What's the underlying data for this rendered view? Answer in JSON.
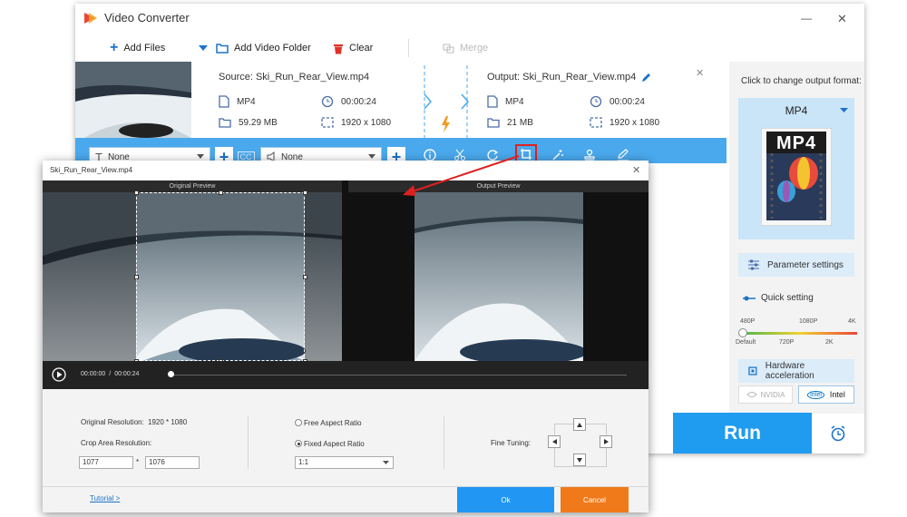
{
  "window": {
    "title": "Video Converter",
    "minimize_glyph": "—",
    "close_glyph": "✕"
  },
  "toolbar": {
    "add_files": "Add Files",
    "add_video_folder": "Add Video Folder",
    "clear": "Clear",
    "merge": "Merge"
  },
  "file_item": {
    "source_label": "Source: Ski_Run_Rear_View.mp4",
    "source_format": "MP4",
    "source_duration": "00:00:24",
    "source_size": "59.29 MB",
    "source_resolution": "1920 x 1080",
    "output_label": "Output: Ski_Run_Rear_View.mp4",
    "output_format": "MP4",
    "output_duration": "00:00:24",
    "output_size": "21 MB",
    "output_resolution": "1920 x 1080",
    "remove_glyph": "✕"
  },
  "edit_bar": {
    "subtitle_select": "None",
    "audio_select": "None",
    "cc_label": "CC",
    "icons": [
      "info-icon",
      "cut-icon",
      "rotate-icon",
      "crop-icon",
      "effects-icon",
      "watermark-icon",
      "edit-icon"
    ]
  },
  "right_panel": {
    "prompt": "Click to change output format:",
    "format_name": "MP4",
    "format_thumb_text": "MP4",
    "parameter_settings": "Parameter settings",
    "quick_setting": "Quick setting",
    "quality_top": [
      "480P",
      "1080P",
      "4K"
    ],
    "quality_bottom": [
      "Default",
      "720P",
      "2K"
    ],
    "hardware_acceleration": "Hardware acceleration",
    "nvidia": "NVIDIA",
    "intel_logo": "intel",
    "intel": "Intel",
    "run": "Run"
  },
  "crop_dialog": {
    "title": "Ski_Run_Rear_View.mp4",
    "close_glyph": "✕",
    "original_preview": "Original Preview",
    "output_preview": "Output Preview",
    "time_current": "00:00:00",
    "time_sep": "/",
    "time_total": "00:00:24",
    "original_resolution_label": "Original Resolution:",
    "original_resolution_value": "1920 * 1080",
    "crop_area_label": "Crop Area Resolution:",
    "crop_width": "1077",
    "crop_sep": "*",
    "crop_height": "1076",
    "free_aspect": "Free Aspect Ratio",
    "fixed_aspect": "Fixed Aspect Ratio",
    "aspect_value": "1:1",
    "fine_tuning": "Fine Tuning:",
    "tutorial": "Tutorial >",
    "ok": "Ok",
    "cancel": "Cancel"
  },
  "colors": {
    "accent": "#2196f3",
    "edit_bar": "#4aa8ec",
    "run": "#1f9bf0",
    "cancel": "#f07a1a",
    "arrow": "#e02020"
  }
}
